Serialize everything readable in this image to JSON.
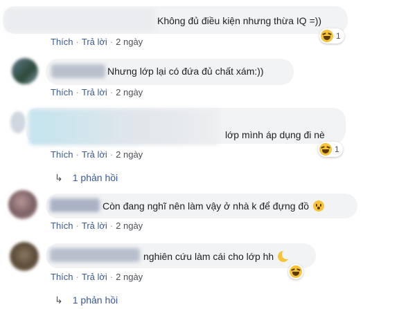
{
  "colors": {
    "link": "#385898",
    "bubble": "#f2f3f5",
    "meta": "#90949c",
    "emoji": "#f7c33b"
  },
  "comments": [
    {
      "text": "Không đủ điều kiện nhưng thừa IQ =))",
      "reaction_icon": "laughing-emoji-icon",
      "reaction_count": "1"
    },
    {
      "text": "Nhưng lớp lại có đứa đủ chất xám:))"
    },
    {
      "text": "lớp mình áp dụng đi nè",
      "reaction_icon": "laughing-emoji-icon",
      "reaction_count": "1",
      "replies": "1 phản hồi"
    },
    {
      "text": "Còn đang nghĩ nên làm vậy ở nhà k để đựng đồ",
      "inline_emoji": "hushed-emoji-icon"
    },
    {
      "text": "nghiên cứu làm cái cho lớp hh",
      "inline_emoji": "crescent-moon-emoji-icon",
      "reaction_icon": "laughing-emoji-icon",
      "replies": "1 phản hồi"
    }
  ],
  "actions": {
    "like": "Thích",
    "reply": "Trả lời",
    "time": "2 ngày"
  }
}
